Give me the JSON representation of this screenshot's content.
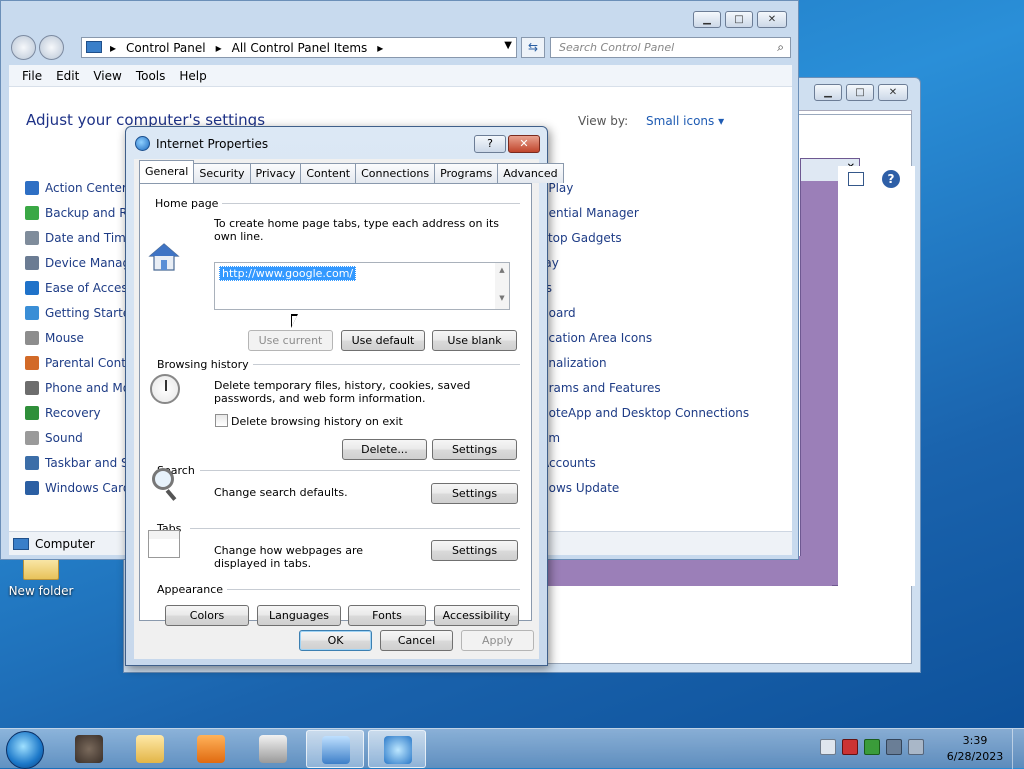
{
  "desktop": {
    "folder_label": "New folder"
  },
  "control_panel": {
    "breadcrumb": [
      "Control Panel",
      "All Control Panel Items"
    ],
    "search_placeholder": "Search Control Panel",
    "menu": [
      "File",
      "Edit",
      "View",
      "Tools",
      "Help"
    ],
    "heading": "Adjust your computer's settings",
    "view_by_label": "View by:",
    "view_by_value": "Small icons",
    "items_left": [
      {
        "label": "Action Center",
        "icon": "flag-icon",
        "color": "#2e6fc4"
      },
      {
        "label": "Backup and Restore",
        "icon": "backup-icon",
        "color": "#3aa845"
      },
      {
        "label": "Date and Time",
        "icon": "clock-icon",
        "color": "#7f8c9b"
      },
      {
        "label": "Device Manager",
        "icon": "device-icon",
        "color": "#6b7c93"
      },
      {
        "label": "Ease of Access Center",
        "icon": "ease-icon",
        "color": "#1f72c9"
      },
      {
        "label": "Getting Started",
        "icon": "start-icon",
        "color": "#3a8ed6"
      },
      {
        "label": "Mouse",
        "icon": "mouse-icon",
        "color": "#8d8d8d"
      },
      {
        "label": "Parental Controls",
        "icon": "parental-icon",
        "color": "#d26a28"
      },
      {
        "label": "Phone and Modem",
        "icon": "phone-icon",
        "color": "#6d6d6d"
      },
      {
        "label": "Recovery",
        "icon": "recovery-icon",
        "color": "#2f8f3a"
      },
      {
        "label": "Sound",
        "icon": "sound-icon",
        "color": "#9a9a9a"
      },
      {
        "label": "Taskbar and Start Menu",
        "icon": "taskbar-icon",
        "color": "#3c6ea8"
      },
      {
        "label": "Windows CardSpace",
        "icon": "cardspace-icon",
        "color": "#2b5fa3"
      }
    ],
    "items_right": [
      {
        "label": "oPlay",
        "color": "#2e7d32"
      },
      {
        "label": "dential Manager",
        "color": "#c49a3b"
      },
      {
        "label": "ktop Gadgets",
        "color": "#3b6fb5"
      },
      {
        "label": "lay",
        "color": "#4a7fc1"
      },
      {
        "label": "ts",
        "color": "#b45f06"
      },
      {
        "label": "board",
        "color": "#777777"
      },
      {
        "label": "fication Area Icons",
        "color": "#5a79a6"
      },
      {
        "label": "onalization",
        "color": "#7d4fa6"
      },
      {
        "label": "grams and Features",
        "color": "#3b75b7"
      },
      {
        "label": "noteApp and Desktop Connections",
        "color": "#2b7ccc"
      },
      {
        "label": "em",
        "color": "#5c6f87"
      },
      {
        "label": "Accounts",
        "color": "#2e8bc9"
      },
      {
        "label": "dows Update",
        "color": "#2d8b3c"
      }
    ],
    "status_label": "Computer"
  },
  "dialog": {
    "title": "Internet Properties",
    "help_label": "?",
    "close_label": "✕",
    "tabs": [
      "General",
      "Security",
      "Privacy",
      "Content",
      "Connections",
      "Programs",
      "Advanced"
    ],
    "home_page": {
      "label": "Home page",
      "instructions": "To create home page tabs, type each address on its own line.",
      "url": "http://www.google.com/",
      "use_current": "Use current",
      "use_default": "Use default",
      "use_blank": "Use blank"
    },
    "browsing_history": {
      "label": "Browsing history",
      "text": "Delete temporary files, history, cookies, saved passwords, and web form information.",
      "checkbox_label": "Delete browsing history on exit",
      "delete": "Delete...",
      "settings": "Settings"
    },
    "search": {
      "label": "Search",
      "text": "Change search defaults.",
      "settings": "Settings"
    },
    "tabs_section": {
      "label": "Tabs",
      "text": "Change how webpages are displayed in tabs.",
      "settings": "Settings"
    },
    "appearance": {
      "label": "Appearance",
      "colors": "Colors",
      "languages": "Languages",
      "fonts": "Fonts",
      "accessibility": "Accessibility"
    },
    "ok": "OK",
    "cancel": "Cancel",
    "apply": "Apply"
  },
  "taskbar": {
    "time": "3:39",
    "date": "6/28/2023",
    "apps": [
      "raccoon-app-icon",
      "explorer-icon",
      "media-player-icon",
      "archive-icon",
      "control-panel-icon",
      "internet-options-icon"
    ]
  },
  "colors": {
    "accent": "#1e3287",
    "link": "#1e5bb3",
    "selection": "#3399ff"
  }
}
